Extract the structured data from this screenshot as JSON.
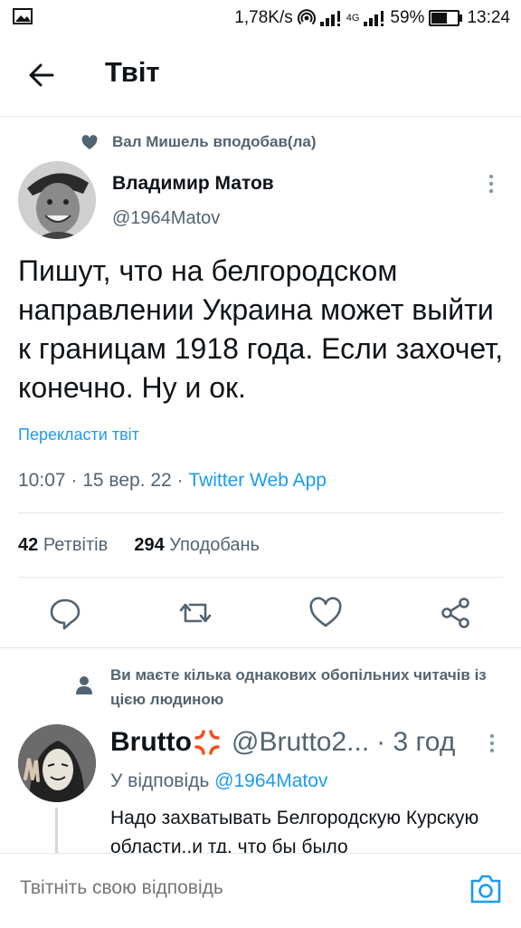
{
  "status_bar": {
    "network_speed": "1,78K/s",
    "network_type": "4G",
    "battery": "59%",
    "battery_level": 0.59,
    "time": "13:24",
    "icons": [
      "image-icon",
      "hotspot-icon",
      "signal-icon",
      "battery-icon"
    ]
  },
  "header": {
    "title": "Твіт"
  },
  "tweet": {
    "social_context": "Вал Мишель вподобав(ла)",
    "author_name": "Владимир Матов",
    "author_handle": "@1964Matov",
    "text": "Пишут, что на белгородском направлении Украина может выйти к границам 1918 года. Если захочет, конечно. Ну и ок.",
    "translate": "Перекласти твіт",
    "time": "10:07",
    "date": "15 вер. 22",
    "source": "Twitter Web App",
    "retweets_count": "42",
    "retweets_label": "Ретвітів",
    "likes_count": "294",
    "likes_label": "Уподобань",
    "actions": [
      "reply-icon",
      "retweet-icon",
      "like-icon",
      "share-icon"
    ]
  },
  "reply": {
    "social_context": "Ви маєте кілька однакових обопільних читачів із цією людиною",
    "author_name": "Brutto",
    "author_handle": "@Brutto2...",
    "time": "3 год",
    "replying_to_label": "У відповідь",
    "replying_to_handle": "@1964Matov",
    "text": "Надо захватывать Белгородскую Курскую области..и тд, что бы было"
  },
  "compose": {
    "placeholder": "Твітніть свою відповідь"
  },
  "colors": {
    "accent": "#1d9bf0",
    "secondary_text": "#536471",
    "divider": "#e1e8ed"
  }
}
